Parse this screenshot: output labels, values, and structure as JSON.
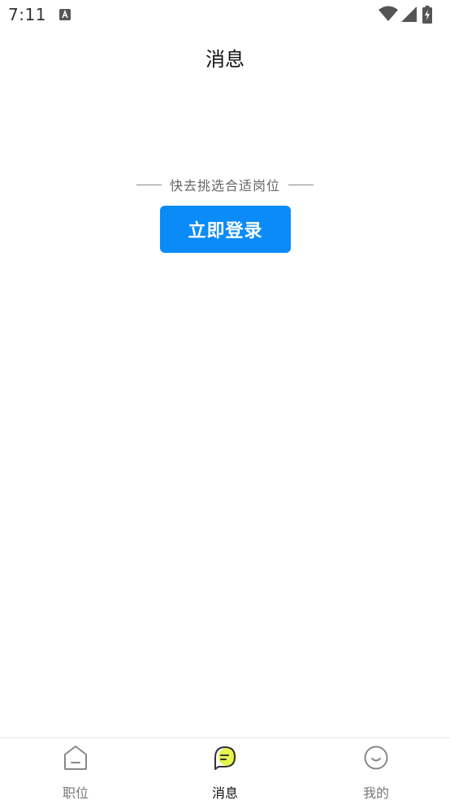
{
  "status_bar": {
    "time": "7:11",
    "notification_icon": "a-letter-icon",
    "wifi_icon": "wifi-icon",
    "signal_icon": "signal-icon",
    "battery_icon": "battery-charging-icon"
  },
  "header": {
    "title": "消息"
  },
  "empty_state": {
    "hint": "快去挑选合适岗位",
    "login_button": "立即登录"
  },
  "bottom_nav": {
    "items": [
      {
        "label": "职位",
        "icon": "home-icon",
        "active": false
      },
      {
        "label": "消息",
        "icon": "chat-bubble-icon",
        "active": true
      },
      {
        "label": "我的",
        "icon": "smile-face-icon",
        "active": false
      }
    ],
    "active_color": "#111111",
    "accent_color": "#e6f54a"
  },
  "colors": {
    "primary_button": "#0a8bf7"
  }
}
